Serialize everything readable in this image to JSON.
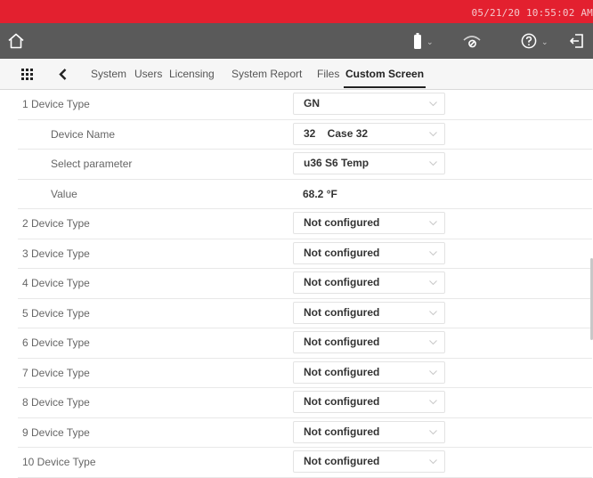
{
  "status_bar": {
    "datetime": "05/21/20 10:55:02 AM",
    "color": "#e3202f"
  },
  "toolbar": {
    "background": "#5a5a5a",
    "icons": [
      "home-icon",
      "battery-icon",
      "signal-icon",
      "help-icon",
      "logout-icon"
    ]
  },
  "nav": {
    "tabs": [
      {
        "label": "System"
      },
      {
        "label": "Users"
      },
      {
        "label": "Licensing"
      },
      {
        "label": "System Report"
      },
      {
        "label": "Files"
      },
      {
        "label": "Custom Screen",
        "active": true
      }
    ]
  },
  "rows": [
    {
      "label": "1 Device Type",
      "value": "GN"
    },
    {
      "label": "Device Name",
      "value": "32    Case 32"
    },
    {
      "label": "Select parameter",
      "value": "u36 S6 Temp"
    },
    {
      "label": "Value",
      "value": "68.2 °F"
    },
    {
      "label": "2 Device Type",
      "value": "Not configured"
    },
    {
      "label": "3 Device Type",
      "value": "Not configured"
    },
    {
      "label": "4 Device Type",
      "value": "Not configured"
    },
    {
      "label": "5 Device Type",
      "value": "Not configured"
    },
    {
      "label": "6 Device Type",
      "value": "Not configured"
    },
    {
      "label": "7 Device Type",
      "value": "Not configured"
    },
    {
      "label": "8 Device Type",
      "value": "Not configured"
    },
    {
      "label": "9 Device Type",
      "value": "Not configured"
    },
    {
      "label": "10 Device Type",
      "value": "Not configured"
    }
  ]
}
